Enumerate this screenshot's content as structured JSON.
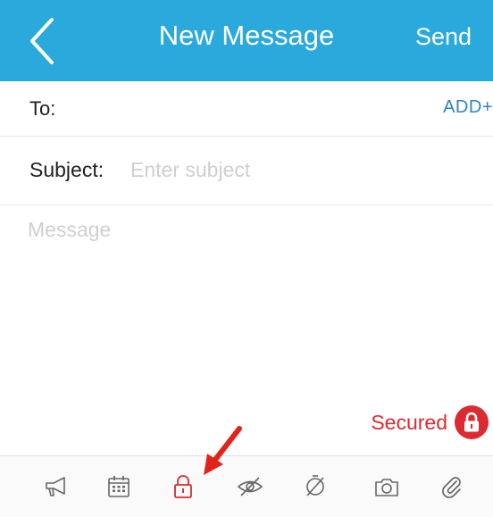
{
  "header": {
    "title": "New Message",
    "back_icon": "chevron-left-icon",
    "send_label": "Send",
    "background_color": "#2aa9dc"
  },
  "recipient": {
    "label": "To:",
    "add_label": "ADD+"
  },
  "subject": {
    "label": "Subject:",
    "placeholder": "Enter subject",
    "value": ""
  },
  "message": {
    "placeholder": "Message",
    "value": ""
  },
  "security": {
    "label": "Secured",
    "icon": "lock-icon",
    "color": "#dc2a32"
  },
  "toolbar": {
    "items": [
      {
        "name": "announcement",
        "icon": "megaphone-icon"
      },
      {
        "name": "schedule",
        "icon": "calendar-icon"
      },
      {
        "name": "secure",
        "icon": "lock-icon",
        "active": true
      },
      {
        "name": "hide",
        "icon": "eye-off-icon"
      },
      {
        "name": "no-reply",
        "icon": "no-reply-icon"
      },
      {
        "name": "camera",
        "icon": "camera-icon"
      },
      {
        "name": "attach",
        "icon": "paperclip-icon"
      }
    ],
    "active_color": "#dc2a32",
    "icon_color": "#666666"
  },
  "annotation": {
    "icon": "red-arrow-icon",
    "color": "#e2231a"
  }
}
